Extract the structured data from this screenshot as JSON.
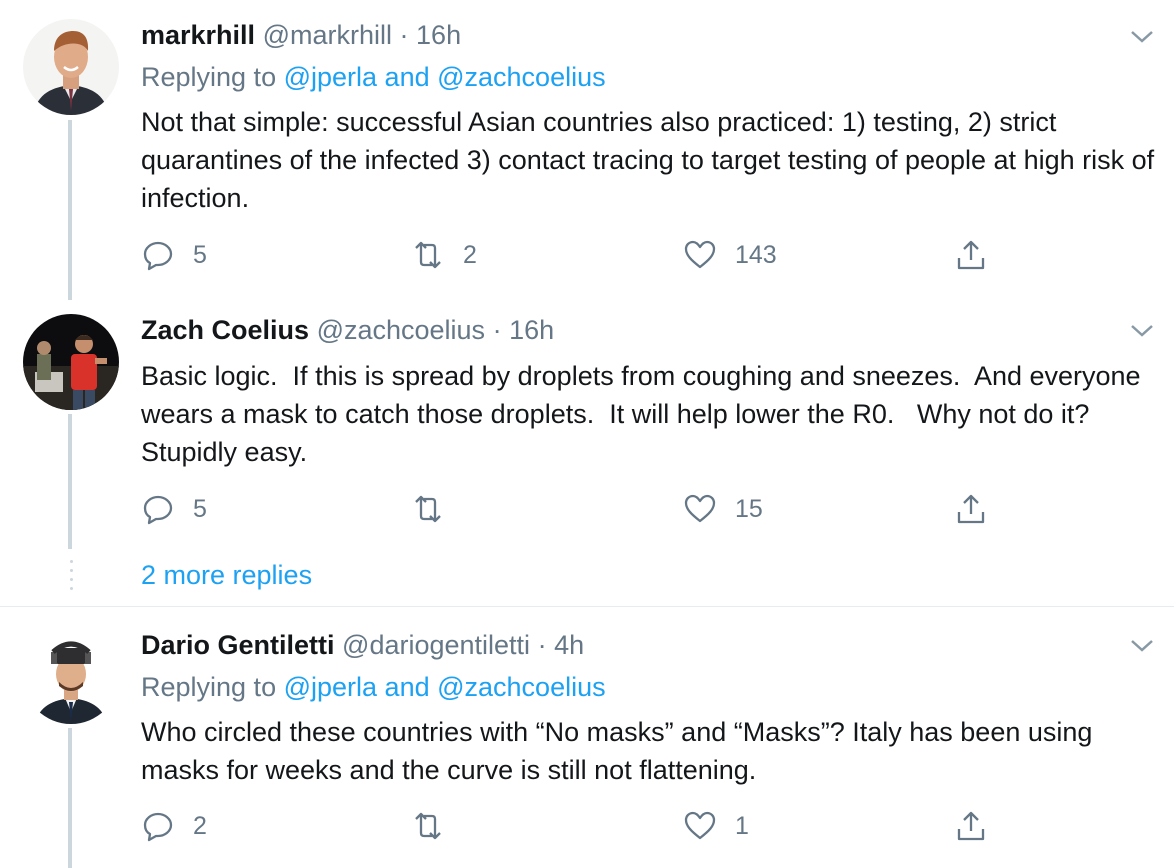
{
  "tweets": [
    {
      "name": "markrhill",
      "handle": "@markrhill",
      "dot": "·",
      "time": "16h",
      "replying_prefix": "Replying to",
      "replying_to": "@jperla and @zachcoelius",
      "body": "Not that simple: successful Asian countries also practiced: 1) testing, 2) strict quarantines of the infected 3) contact tracing to target testing of people at high risk of infection.",
      "replies": "5",
      "retweets": "2",
      "likes": "143"
    },
    {
      "name": "Zach Coelius",
      "handle": "@zachcoelius",
      "dot": "·",
      "time": "16h",
      "body": "Basic logic.  If this is spread by droplets from coughing and sneezes.  And everyone wears a mask to catch those droplets.  It will help lower the R0.   Why not do it?  Stupidly easy.",
      "replies": "5",
      "retweets": "",
      "likes": "15"
    },
    {
      "name": "Dario Gentiletti",
      "handle": "@dariogentiletti",
      "dot": "·",
      "time": "4h",
      "replying_prefix": "Replying to",
      "replying_to": "@jperla and @zachcoelius",
      "body": "Who circled these countries with “No masks” and “Masks”? Italy has been using masks for weeks and the curve is still not flattening.",
      "replies": "2",
      "retweets": "",
      "likes": "1"
    }
  ],
  "more_replies": "2 more replies",
  "colors": {
    "link": "#1da1f2",
    "secondary": "#657786",
    "thread_line": "#ccd6dd"
  },
  "icons": [
    "reply-icon",
    "retweet-icon",
    "like-icon",
    "share-icon",
    "chevron-down-icon"
  ]
}
